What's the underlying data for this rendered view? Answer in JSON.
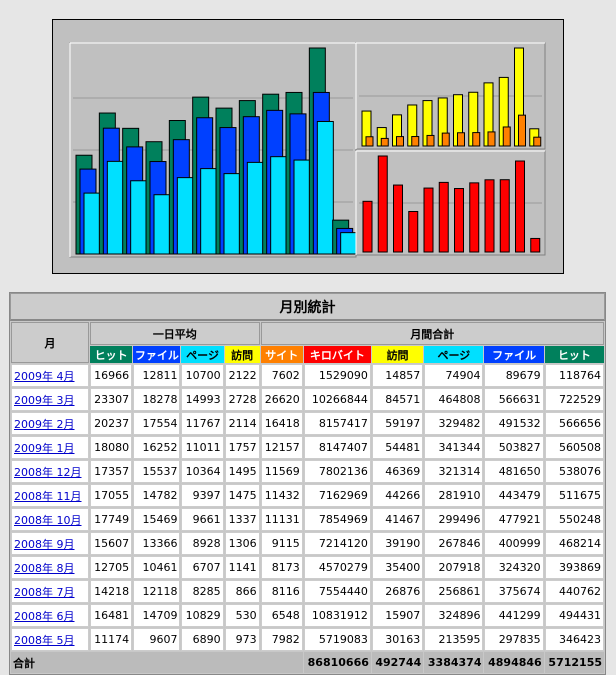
{
  "colors": {
    "hit": "#00805c",
    "file": "#0040ff",
    "page": "#00e0ff",
    "visit": "#ffff00",
    "site": "#ff8000",
    "kbyte": "#ff0000"
  },
  "stats": {
    "title": "月別統計",
    "month_header": "月",
    "daily_avg_header": "一日平均",
    "monthly_total_header": "月間合計",
    "daily_cols": [
      "ヒット",
      "ファイル",
      "ページ",
      "訪問"
    ],
    "total_cols": [
      "サイト",
      "キロバイト",
      "訪問",
      "ページ",
      "ファイル",
      "ヒット"
    ],
    "rows": [
      {
        "month": "2009年 4月",
        "d": [
          "16966",
          "12811",
          "10700",
          "2122"
        ],
        "t": [
          "7602",
          "1529090",
          "14857",
          "74904",
          "89679",
          "118764"
        ]
      },
      {
        "month": "2009年 3月",
        "d": [
          "23307",
          "18278",
          "14993",
          "2728"
        ],
        "t": [
          "26620",
          "10266844",
          "84571",
          "464808",
          "566631",
          "722529"
        ]
      },
      {
        "month": "2009年 2月",
        "d": [
          "20237",
          "17554",
          "11767",
          "2114"
        ],
        "t": [
          "16418",
          "8157417",
          "59197",
          "329482",
          "491532",
          "566656"
        ]
      },
      {
        "month": "2009年 1月",
        "d": [
          "18080",
          "16252",
          "11011",
          "1757"
        ],
        "t": [
          "12157",
          "8147407",
          "54481",
          "341344",
          "503827",
          "560508"
        ]
      },
      {
        "month": "2008年 12月",
        "d": [
          "17357",
          "15537",
          "10364",
          "1495"
        ],
        "t": [
          "11569",
          "7802136",
          "46369",
          "321314",
          "481650",
          "538076"
        ]
      },
      {
        "month": "2008年 11月",
        "d": [
          "17055",
          "14782",
          "9397",
          "1475"
        ],
        "t": [
          "11432",
          "7162969",
          "44266",
          "281910",
          "443479",
          "511675"
        ]
      },
      {
        "month": "2008年 10月",
        "d": [
          "17749",
          "15469",
          "9661",
          "1337"
        ],
        "t": [
          "11131",
          "7854969",
          "41467",
          "299496",
          "477921",
          "550248"
        ]
      },
      {
        "month": "2008年 9月",
        "d": [
          "15607",
          "13366",
          "8928",
          "1306"
        ],
        "t": [
          "9115",
          "7214120",
          "39190",
          "267846",
          "400999",
          "468214"
        ]
      },
      {
        "month": "2008年 8月",
        "d": [
          "12705",
          "10461",
          "6707",
          "1141"
        ],
        "t": [
          "8173",
          "4570279",
          "35400",
          "207918",
          "324320",
          "393869"
        ]
      },
      {
        "month": "2008年 7月",
        "d": [
          "14218",
          "12118",
          "8285",
          "866"
        ],
        "t": [
          "8116",
          "7554440",
          "26876",
          "256861",
          "375674",
          "440762"
        ]
      },
      {
        "month": "2008年 6月",
        "d": [
          "16481",
          "14709",
          "10829",
          "530"
        ],
        "t": [
          "6548",
          "10831912",
          "15907",
          "324896",
          "441299",
          "494431"
        ]
      },
      {
        "month": "2008年 5月",
        "d": [
          "11174",
          "9607",
          "6890",
          "973"
        ],
        "t": [
          "7982",
          "5719083",
          "30163",
          "213595",
          "297835",
          "346423"
        ]
      }
    ],
    "total_label": "合計",
    "totals": [
      "86810666",
      "492744",
      "3384374",
      "4894846",
      "5712155"
    ]
  },
  "chart_data": {
    "type": "bar",
    "categories": [
      "2008-05",
      "2008-06",
      "2008-07",
      "2008-08",
      "2008-09",
      "2008-10",
      "2008-11",
      "2008-12",
      "2009-01",
      "2009-02",
      "2009-03",
      "2009-04"
    ],
    "panels": [
      {
        "name": "hits-files-pages",
        "series": [
          {
            "name": "ヒット",
            "values": [
              346423,
              494431,
              440762,
              393869,
              468214,
              550248,
              511675,
              538076,
              560508,
              566656,
              722529,
              118764
            ]
          },
          {
            "name": "ファイル",
            "values": [
              297835,
              441299,
              375674,
              324320,
              400999,
              477921,
              443479,
              481650,
              503827,
              491532,
              566631,
              89679
            ]
          },
          {
            "name": "ページ",
            "values": [
              213595,
              324896,
              256861,
              207918,
              267846,
              299496,
              281910,
              321314,
              341344,
              329482,
              464808,
              74904
            ]
          }
        ]
      },
      {
        "name": "visits-sites",
        "series": [
          {
            "name": "訪問",
            "values": [
              30163,
              15907,
              26876,
              35400,
              39190,
              41467,
              44266,
              46369,
              54481,
              59197,
              84571,
              14857
            ]
          },
          {
            "name": "サイト",
            "values": [
              7982,
              6548,
              8116,
              8173,
              9115,
              11131,
              11432,
              11569,
              12157,
              16418,
              26620,
              7602
            ]
          }
        ]
      },
      {
        "name": "kbytes",
        "series": [
          {
            "name": "キロバイト",
            "values": [
              5719083,
              10831912,
              7554440,
              4570279,
              7214120,
              7854969,
              7162969,
              7802136,
              8147407,
              8157417,
              10266844,
              1529090
            ]
          }
        ]
      }
    ]
  }
}
